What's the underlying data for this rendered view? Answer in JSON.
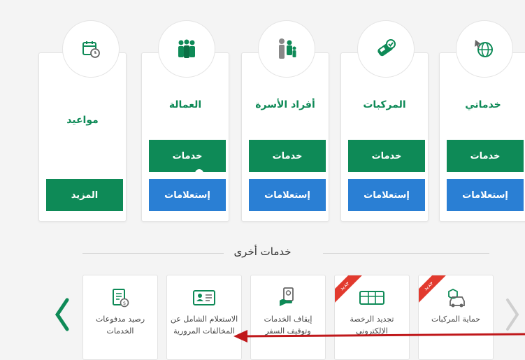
{
  "cards": [
    {
      "title": "خدماتي",
      "services_label": "خدمات",
      "inquiries_label": "إستعلامات",
      "icon": "globe-cursor-icon"
    },
    {
      "title": "المركبات",
      "services_label": "خدمات",
      "inquiries_label": "إستعلامات",
      "icon": "car-check-icon"
    },
    {
      "title": "أفراد الأسرة",
      "services_label": "خدمات",
      "inquiries_label": "إستعلامات",
      "icon": "family-icon"
    },
    {
      "title": "العمالة",
      "services_label": "خدمات",
      "inquiries_label": "إستعلامات",
      "icon": "workers-icon"
    },
    {
      "title": "مواعيد",
      "more_label": "المزيد",
      "icon": "calendar-clock-icon"
    }
  ],
  "other_services": {
    "title": "خدمات أخرى",
    "items": [
      {
        "label": "رصيد مدفوعات الخدمات",
        "badge": ""
      },
      {
        "label": "الاستعلام الشامل عن المخالفات المرورية",
        "badge": ""
      },
      {
        "label": "إيقاف الخدمات وتوقيف السفر",
        "badge": ""
      },
      {
        "label": "تجديد الرخصة الإلكتروني",
        "badge": "جديد"
      },
      {
        "label": "حماية المركبات",
        "badge": "جديد"
      }
    ]
  },
  "colors": {
    "green": "#0e8a57",
    "blue": "#2a7fd4",
    "red": "#e23a2e"
  }
}
